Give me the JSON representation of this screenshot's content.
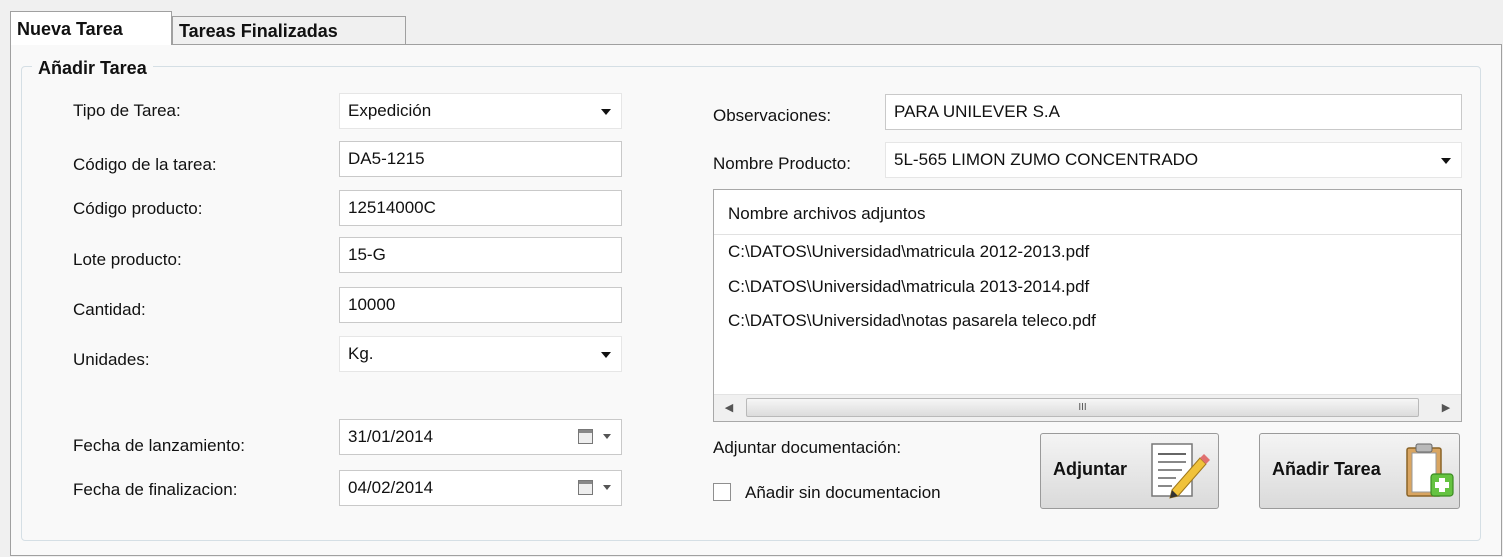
{
  "tabs": [
    {
      "label": "Nueva Tarea"
    },
    {
      "label": "Tareas Finalizadas"
    }
  ],
  "group": {
    "title": "Añadir Tarea"
  },
  "form": {
    "tipo_tarea": {
      "label": "Tipo de Tarea:",
      "value": "Expedición"
    },
    "codigo_tarea": {
      "label": "Código de la tarea:",
      "value": "DA5-1215"
    },
    "codigo_producto": {
      "label": "Código producto:",
      "value": "12514000C"
    },
    "lote_producto": {
      "label": "Lote producto:",
      "value": "15-G"
    },
    "cantidad": {
      "label": "Cantidad:",
      "value": "10000"
    },
    "unidades": {
      "label": "Unidades:",
      "value": "Kg."
    },
    "fecha_lanzamiento": {
      "label": "Fecha de lanzamiento:",
      "value": "31/01/2014"
    },
    "fecha_finalizacion": {
      "label": "Fecha de finalizacion:",
      "value": "04/02/2014"
    },
    "observaciones": {
      "label": "Observaciones:",
      "value": "PARA UNILEVER S.A"
    },
    "nombre_producto": {
      "label": "Nombre Producto:",
      "value": "5L-565 LIMON ZUMO CONCENTRADO"
    }
  },
  "attachments": {
    "header": "Nombre archivos adjuntos",
    "items": [
      "C:\\DATOS\\Universidad\\matricula 2012-2013.pdf",
      "C:\\DATOS\\Universidad\\matricula 2013-2014.pdf",
      "C:\\DATOS\\Universidad\\notas pasarela teleco.pdf"
    ],
    "scroll_thumb": "III"
  },
  "adjuntar_doc_label": "Adjuntar documentación:",
  "sin_doc_label": "Añadir sin documentacion",
  "buttons": {
    "adjuntar": "Adjuntar",
    "anadir": "Añadir Tarea"
  }
}
